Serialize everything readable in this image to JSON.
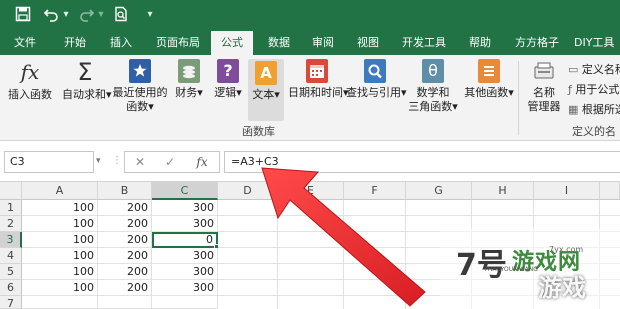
{
  "quick_access": {
    "save_icon": "save-icon",
    "undo_icon": "undo-icon",
    "redo_icon": "redo-icon",
    "preview_icon": "print-preview-icon",
    "customize_icon": "chevron-down-icon"
  },
  "tabs": [
    "文件",
    "开始",
    "插入",
    "页面布局",
    "公式",
    "数据",
    "审阅",
    "视图",
    "开发工具",
    "帮助",
    "方方格子",
    "DIY工具"
  ],
  "active_tab": "公式",
  "ribbon": {
    "insert_function": {
      "icon": "fx",
      "label": "插入函数"
    },
    "autosum": {
      "icon": "Σ",
      "label1": "自动求和",
      "arrow": "▾"
    },
    "recent": {
      "label1": "最近使用的",
      "label2": "函数",
      "arrow": "▾"
    },
    "finance": {
      "label1": "财务",
      "arrow": "▾"
    },
    "logic": {
      "label1": "逻辑",
      "arrow": "▾"
    },
    "text": {
      "label1": "文本",
      "arrow": "▾"
    },
    "datetime": {
      "label1": "日期和时间",
      "arrow": "▾"
    },
    "lookup": {
      "label1": "查找与引用",
      "arrow": "▾"
    },
    "math": {
      "label1": "数学和",
      "label2": "三角函数",
      "arrow": "▾"
    },
    "other": {
      "label1": "其他函数",
      "arrow": "▾"
    },
    "group_label": "函数库",
    "name_manager": {
      "label1": "名称",
      "label2": "管理器"
    },
    "define_name": "定义名称",
    "use_in_formula": "用于公式",
    "create_from_selection": "根据所选",
    "defined_names_group": "定义的名称"
  },
  "formula_bar": {
    "name_box": "C3",
    "cancel": "✕",
    "enter": "✓",
    "fx": "fx",
    "formula": "=A3+C3"
  },
  "grid": {
    "columns": [
      "A",
      "B",
      "C",
      "D",
      "E",
      "F",
      "G",
      "H",
      "I"
    ],
    "rows": [
      "1",
      "2",
      "3",
      "4",
      "5",
      "6",
      "7"
    ],
    "cells": [
      [
        "100",
        "200",
        "300"
      ],
      [
        "100",
        "200",
        "300"
      ],
      [
        "100",
        "200",
        "0"
      ],
      [
        "100",
        "200",
        "300"
      ],
      [
        "100",
        "200",
        "300"
      ],
      [
        "100",
        "200",
        "300"
      ],
      [
        "",
        "",
        ""
      ]
    ],
    "active_cell": "C3"
  },
  "watermark": {
    "letters": "7号",
    "text": "游戏网",
    "text2": "游戏",
    "small": "7HAOYOUXIWANG",
    "domain": "7yx.com"
  },
  "colors": {
    "accent": "#217346",
    "arrow": "#e8262b"
  }
}
